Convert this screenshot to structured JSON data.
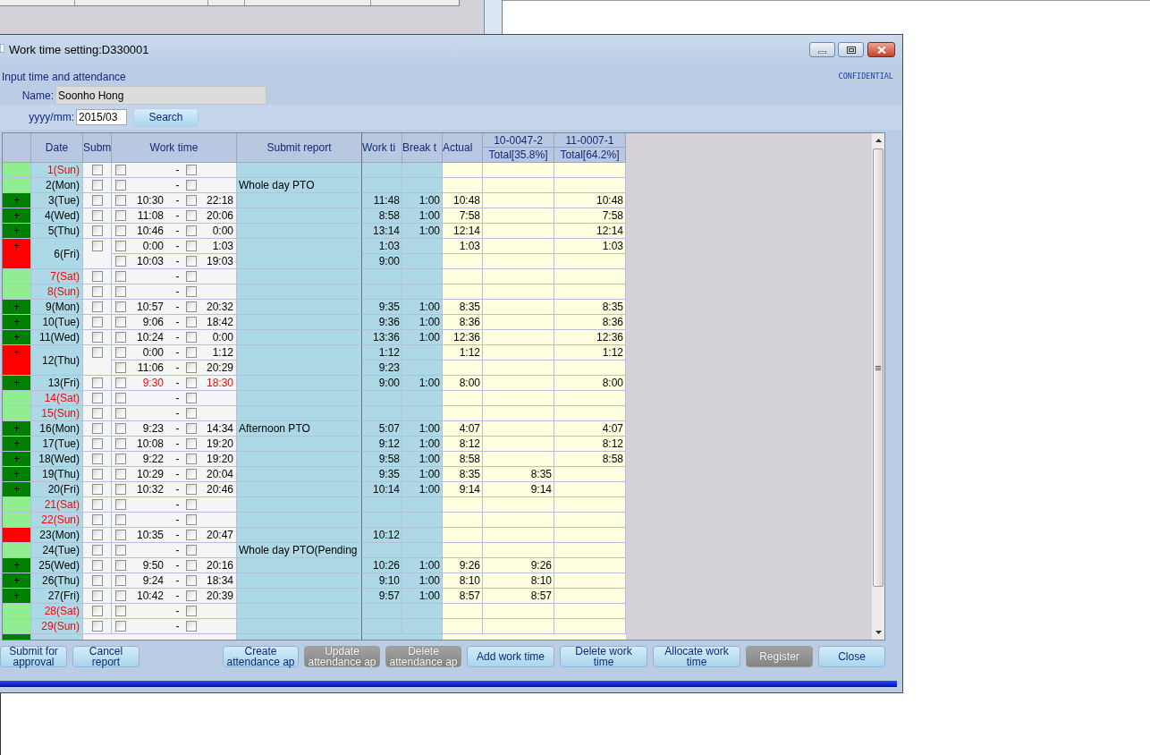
{
  "window": {
    "title": "Work time setting:D330001"
  },
  "form": {
    "heading": "Input time and attendance",
    "confidential": "CONFIDENTIAL",
    "name_label": "Name:",
    "name_value": "Soonho Hong",
    "month_label": "yyyy/mm:",
    "month_value": "2015/03",
    "search_button": "Search"
  },
  "table": {
    "columns": [
      "Date",
      "Subm",
      "Work time",
      "Submit report",
      "Work ti",
      "Break t",
      "Actual"
    ],
    "projects": [
      {
        "code": "10-0047-2",
        "total": "Total[35.8%]"
      },
      {
        "code": "11-0007-1",
        "total": "Total[64.2%]"
      }
    ],
    "rows": [
      {
        "date": "1(Sun)",
        "holiday": true,
        "color": "#90ee90",
        "submit_checked": false,
        "entries": [
          {
            "start_checked": false,
            "dash": "-",
            "end_checked": false
          }
        ]
      },
      {
        "date": "2(Mon)",
        "holiday": false,
        "color": "#90ee90",
        "submit_checked": false,
        "report": "Whole day PTO",
        "entries": [
          {
            "start_checked": false,
            "dash": "-",
            "end_checked": false
          }
        ]
      },
      {
        "date": "3(Tue)",
        "holiday": false,
        "color": "#008000",
        "mark": "+",
        "submit_checked": false,
        "entries": [
          {
            "start_checked": false,
            "start": "10:30",
            "dash": "-",
            "end_checked": false,
            "end": "22:18",
            "work": "11:48",
            "break": "1:00",
            "actual": "10:48",
            "project_2": "10:48"
          }
        ]
      },
      {
        "date": "4(Wed)",
        "holiday": false,
        "color": "#008000",
        "mark": "+",
        "submit_checked": false,
        "entries": [
          {
            "start_checked": false,
            "start": "11:08",
            "dash": "-",
            "end_checked": false,
            "end": "20:06",
            "work": "8:58",
            "break": "1:00",
            "actual": "7:58",
            "project_2": "7:58"
          }
        ]
      },
      {
        "date": "5(Thu)",
        "holiday": false,
        "color": "#008000",
        "mark": "+",
        "submit_checked": false,
        "entries": [
          {
            "start_checked": false,
            "start": "10:46",
            "dash": "-",
            "end_checked": false,
            "end": "0:00",
            "work": "13:14",
            "break": "1:00",
            "actual": "12:14",
            "project_2": "12:14"
          }
        ]
      },
      {
        "date": "6(Fri)",
        "holiday": false,
        "color": "#ff0000",
        "mark": "+",
        "submit_checked": false,
        "entries": [
          {
            "start_checked": false,
            "start": "0:00",
            "dash": "-",
            "end_checked": false,
            "end": "1:03",
            "work": "1:03",
            "actual": "1:03",
            "project_2": "1:03"
          },
          {
            "start_checked": false,
            "start": "10:03",
            "dash": "-",
            "end_checked": false,
            "end": "19:03",
            "work": "9:00"
          }
        ]
      },
      {
        "date": "7(Sat)",
        "holiday": true,
        "color": "#90ee90",
        "submit_checked": false,
        "entries": [
          {
            "start_checked": false,
            "dash": "-",
            "end_checked": false
          }
        ]
      },
      {
        "date": "8(Sun)",
        "holiday": true,
        "color": "#90ee90",
        "submit_checked": false,
        "entries": [
          {
            "start_checked": false,
            "dash": "-",
            "end_checked": false
          }
        ]
      },
      {
        "date": "9(Mon)",
        "holiday": false,
        "color": "#008000",
        "mark": "+",
        "submit_checked": false,
        "entries": [
          {
            "start_checked": false,
            "start": "10:57",
            "dash": "-",
            "end_checked": false,
            "end": "20:32",
            "work": "9:35",
            "break": "1:00",
            "actual": "8:35",
            "project_2": "8:35"
          }
        ]
      },
      {
        "date": "10(Tue)",
        "holiday": false,
        "color": "#008000",
        "mark": "+",
        "submit_checked": false,
        "entries": [
          {
            "start_checked": false,
            "start": "9:06",
            "dash": "-",
            "end_checked": false,
            "end": "18:42",
            "work": "9:36",
            "break": "1:00",
            "actual": "8:36",
            "project_2": "8:36"
          }
        ]
      },
      {
        "date": "11(Wed)",
        "holiday": false,
        "color": "#008000",
        "mark": "+",
        "submit_checked": false,
        "entries": [
          {
            "start_checked": false,
            "start": "10:24",
            "dash": "-",
            "end_checked": false,
            "end": "0:00",
            "work": "13:36",
            "break": "1:00",
            "actual": "12:36",
            "project_2": "12:36"
          }
        ]
      },
      {
        "date": "12(Thu)",
        "holiday": false,
        "color": "#ff0000",
        "mark": "+",
        "submit_checked": false,
        "entries": [
          {
            "start_checked": false,
            "start": "0:00",
            "dash": "-",
            "end_checked": false,
            "end": "1:12",
            "work": "1:12",
            "actual": "1:12",
            "project_2": "1:12"
          },
          {
            "start_checked": false,
            "start": "11:06",
            "dash": "-",
            "end_checked": false,
            "end": "20:29",
            "work": "9:23"
          }
        ]
      },
      {
        "date": "13(Fri)",
        "holiday": false,
        "color": "#008000",
        "mark": "+",
        "submit_checked": false,
        "entries": [
          {
            "start_checked": false,
            "start": "9:30",
            "dash": "-",
            "end_checked": false,
            "end": "18:30",
            "color": "#ff0000",
            "work": "9:00",
            "break": "1:00",
            "actual": "8:00",
            "project_2": "8:00"
          }
        ]
      },
      {
        "date": "14(Sat)",
        "holiday": true,
        "color": "#90ee90",
        "submit_checked": false,
        "entries": [
          {
            "start_checked": false,
            "dash": "-",
            "end_checked": false
          }
        ]
      },
      {
        "date": "15(Sun)",
        "holiday": true,
        "color": "#90ee90",
        "submit_checked": false,
        "entries": [
          {
            "start_checked": false,
            "dash": "-",
            "end_checked": false
          }
        ]
      },
      {
        "date": "16(Mon)",
        "holiday": false,
        "color": "#008000",
        "mark": "+",
        "submit_checked": false,
        "report": "Afternoon PTO",
        "entries": [
          {
            "start_checked": false,
            "start": "9:23",
            "dash": "-",
            "end_checked": false,
            "end": "14:34",
            "work": "5:07",
            "break": "1:00",
            "actual": "4:07",
            "project_2": "4:07"
          }
        ]
      },
      {
        "date": "17(Tue)",
        "holiday": false,
        "color": "#008000",
        "mark": "+",
        "submit_checked": false,
        "entries": [
          {
            "start_checked": false,
            "start": "10:08",
            "dash": "-",
            "end_checked": false,
            "end": "19:20",
            "work": "9:12",
            "break": "1:00",
            "actual": "8:12",
            "project_2": "8:12"
          }
        ]
      },
      {
        "date": "18(Wed)",
        "holiday": false,
        "color": "#008000",
        "mark": "+",
        "submit_checked": false,
        "entries": [
          {
            "start_checked": false,
            "start": "9:22",
            "dash": "-",
            "end_checked": false,
            "end": "19:20",
            "work": "9:58",
            "break": "1:00",
            "actual": "8:58",
            "project_2": "8:58"
          }
        ]
      },
      {
        "date": "19(Thu)",
        "holiday": false,
        "color": "#008000",
        "mark": "+",
        "submit_checked": false,
        "entries": [
          {
            "start_checked": false,
            "start": "10:29",
            "dash": "-",
            "end_checked": false,
            "end": "20:04",
            "work": "9:35",
            "break": "1:00",
            "actual": "8:35",
            "project_1": "8:35"
          }
        ]
      },
      {
        "date": "20(Fri)",
        "holiday": false,
        "color": "#008000",
        "mark": "+",
        "submit_checked": false,
        "entries": [
          {
            "start_checked": false,
            "start": "10:32",
            "dash": "-",
            "end_checked": false,
            "end": "20:46",
            "work": "10:14",
            "break": "1:00",
            "actual": "9:14",
            "project_1": "9:14"
          }
        ]
      },
      {
        "date": "21(Sat)",
        "holiday": true,
        "color": "#90ee90",
        "submit_checked": false,
        "entries": [
          {
            "start_checked": false,
            "dash": "-",
            "end_checked": false
          }
        ]
      },
      {
        "date": "22(Sun)",
        "holiday": true,
        "color": "#90ee90",
        "submit_checked": false,
        "entries": [
          {
            "start_checked": false,
            "dash": "-",
            "end_checked": false
          }
        ]
      },
      {
        "date": "23(Mon)",
        "holiday": false,
        "color": "#ff0000",
        "submit_checked": false,
        "entries": [
          {
            "start_checked": false,
            "start": "10:35",
            "dash": "-",
            "end_checked": false,
            "end": "20:47",
            "work": "10:12"
          }
        ]
      },
      {
        "date": "24(Tue)",
        "holiday": false,
        "color": "#90ee90",
        "submit_checked": false,
        "report": "Whole day PTO(Pending",
        "entries": [
          {
            "start_checked": false,
            "dash": "-",
            "end_checked": false
          }
        ]
      },
      {
        "date": "25(Wed)",
        "holiday": false,
        "color": "#008000",
        "mark": "+",
        "submit_checked": false,
        "entries": [
          {
            "start_checked": false,
            "start": "9:50",
            "dash": "-",
            "end_checked": false,
            "end": "20:16",
            "work": "10:26",
            "break": "1:00",
            "actual": "9:26",
            "project_1": "9:26"
          }
        ]
      },
      {
        "date": "26(Thu)",
        "holiday": false,
        "color": "#008000",
        "mark": "+",
        "submit_checked": false,
        "entries": [
          {
            "start_checked": false,
            "start": "9:24",
            "dash": "-",
            "end_checked": false,
            "end": "18:34",
            "work": "9:10",
            "break": "1:00",
            "actual": "8:10",
            "project_1": "8:10"
          }
        ]
      },
      {
        "date": "27(Fri)",
        "holiday": false,
        "color": "#008000",
        "mark": "+",
        "submit_checked": false,
        "entries": [
          {
            "start_checked": false,
            "start": "10:42",
            "dash": "-",
            "end_checked": false,
            "end": "20:39",
            "work": "9:57",
            "break": "1:00",
            "actual": "8:57",
            "project_1": "8:57"
          }
        ]
      },
      {
        "date": "28(Sat)",
        "holiday": true,
        "color": "#90ee90",
        "submit_checked": false,
        "entries": [
          {
            "start_checked": false,
            "dash": "-",
            "end_checked": false
          }
        ]
      },
      {
        "date": "29(Sun)",
        "holiday": true,
        "color": "#90ee90",
        "submit_checked": false,
        "entries": [
          {
            "start_checked": false,
            "dash": "-",
            "end_checked": false
          }
        ]
      }
    ],
    "partial_row": {
      "color": "#008000"
    }
  },
  "buttons_left": [
    {
      "label": "Submit for approval",
      "disabled": false
    },
    {
      "label": "Cancel report",
      "disabled": false
    }
  ],
  "buttons_right": [
    {
      "label": "Create attendance ap",
      "disabled": false
    },
    {
      "label": "Update attendance ap",
      "disabled": true
    },
    {
      "label": "Delete attendance ap",
      "disabled": true
    },
    {
      "label": "Add work time",
      "disabled": false
    },
    {
      "label": "Delete work time",
      "disabled": false
    },
    {
      "label": "Allocate work time",
      "disabled": false
    },
    {
      "label": "Register",
      "disabled": true
    },
    {
      "label": "Close",
      "disabled": false
    }
  ]
}
